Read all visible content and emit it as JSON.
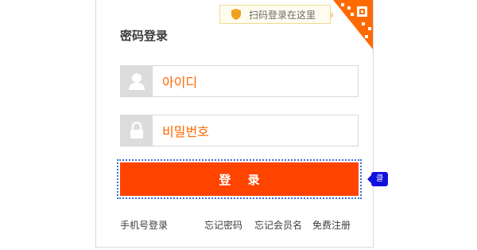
{
  "login": {
    "title": "密码登录",
    "qr_tip": "扫码登录在这里",
    "username_value": "아이디",
    "password_value": "비밀번호",
    "submit_label": "登 录",
    "click_tag": "클릭"
  },
  "footer": {
    "phone_login": "手机号登录",
    "forgot_password": "忘记密码",
    "forgot_username": "忘记会员名",
    "register": "免费注册"
  },
  "colors": {
    "accent": "#ff4400",
    "input_text": "#ff6600",
    "tag_blue": "#1111dd"
  },
  "icons": {
    "qr": "qr-code-icon",
    "shield": "shield-icon",
    "user": "user-icon",
    "lock": "lock-icon"
  }
}
